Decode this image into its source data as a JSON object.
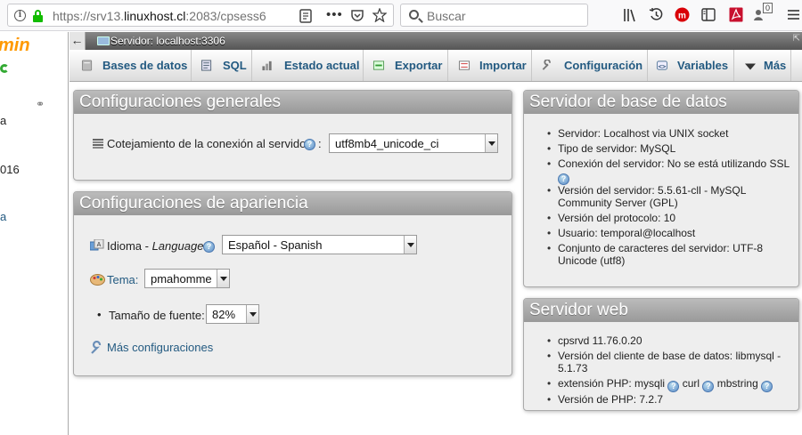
{
  "browser": {
    "url_prefix": "https://srv13.",
    "url_domain": "linuxhost.cl",
    "url_suffix": ":2083/cpsess6",
    "search_placeholder": "Buscar",
    "badge_count": "0"
  },
  "leftnav": {
    "logo_text": "min",
    "text1": "a",
    "text2": "016",
    "text3": "a"
  },
  "serverbar": {
    "back_arrow": "←",
    "title": "Servidor: localhost:3306"
  },
  "tabs": [
    {
      "label": "Bases de datos",
      "icon": "database-icon"
    },
    {
      "label": "SQL",
      "icon": "sql-icon"
    },
    {
      "label": "Estado actual",
      "icon": "status-icon"
    },
    {
      "label": "Exportar",
      "icon": "export-icon"
    },
    {
      "label": "Importar",
      "icon": "import-icon"
    },
    {
      "label": "Configuración",
      "icon": "wrench-icon"
    },
    {
      "label": "Variables",
      "icon": "variables-icon"
    },
    {
      "label": "Más",
      "icon": "chevron-down-icon"
    }
  ],
  "general_settings": {
    "title": "Configuraciones generales",
    "collation_label": "Cotejamiento de la conexión al servidor",
    "collation_colon": ":",
    "collation_value": "utf8mb4_unicode_ci"
  },
  "appearance_settings": {
    "title": "Configuraciones de apariencia",
    "language_label": "Idioma - ",
    "language_label_italic": "Language",
    "language_value": "Español - Spanish",
    "theme_label": "Tema:",
    "theme_value": "pmahomme",
    "fontsize_label": "Tamaño de fuente:",
    "fontsize_value": "82%",
    "more_settings": "Más configuraciones"
  },
  "db_server": {
    "title": "Servidor de base de datos",
    "items": [
      "Servidor: Localhost via UNIX socket",
      "Tipo de servidor: MySQL",
      "Conexión del servidor: No se está utilizando SSL",
      "Versión del servidor: 5.5.61-cll - MySQL Community Server (GPL)",
      "Versión del protocolo: 10",
      "Usuario: temporal@localhost",
      "Conjunto de caracteres del servidor: UTF-8 Unicode (utf8)"
    ]
  },
  "web_server": {
    "title": "Servidor web",
    "items": [
      "cpsrvd 11.76.0.20",
      "Versión del cliente de base de datos: libmysql - 5.1.73",
      "extensión PHP: mysqli",
      "curl",
      "mbstring",
      "Versión de PHP: 7.2.7"
    ]
  },
  "colors": {
    "link": "#235a81",
    "panel_bg": "#eeeeee",
    "header_grey": "#999999",
    "logo_orange": "#ff9900",
    "secure_green": "#12bc00"
  }
}
